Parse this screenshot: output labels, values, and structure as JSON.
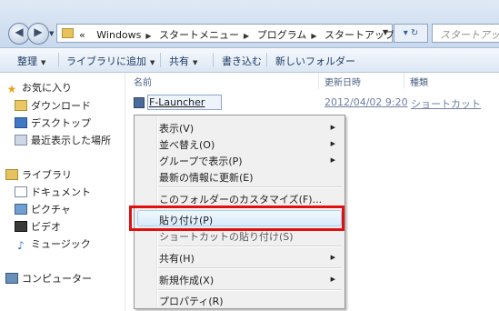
{
  "address": {
    "crumbs": [
      "Windows",
      "スタートメニュー",
      "プログラム",
      "スタートアップ"
    ],
    "chevrons": "«",
    "search_placeholder": "スタートアップ"
  },
  "toolbar": {
    "organize": "整理",
    "add_to_library": "ライブラリに追加",
    "share": "共有",
    "burn": "書き込む",
    "new_folder": "新しいフォルダー"
  },
  "sidebar": {
    "favorites": "お気に入り",
    "downloads": "ダウンロード",
    "desktop": "デスクトップ",
    "recent": "最近表示した場所",
    "libraries": "ライブラリ",
    "documents": "ドキュメント",
    "pictures": "ピクチャ",
    "videos": "ビデオ",
    "music": "ミュージック",
    "computer": "コンピューター"
  },
  "columns": {
    "name": "名前",
    "modified": "更新日時",
    "type": "種類"
  },
  "files": [
    {
      "name": "F-Launcher",
      "modified": "2012/04/02 9:20",
      "type": "ショートカット"
    }
  ],
  "context_menu": {
    "view": "表示(V)",
    "sort": "並べ替え(O)",
    "group": "グループで表示(P)",
    "refresh": "最新の情報に更新(E)",
    "customize": "このフォルダーのカスタマイズ(F)...",
    "paste": "貼り付け(P)",
    "paste_shortcut": "ショートカットの貼り付け(S)",
    "share": "共有(H)",
    "new": "新規作成(X)",
    "properties": "プロパティ(R)"
  },
  "colors": {
    "highlight_border": "#e11010",
    "menu_background": "#f0f0f0"
  }
}
